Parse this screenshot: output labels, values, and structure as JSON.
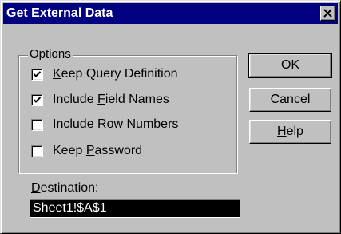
{
  "dialog": {
    "title": "Get External Data",
    "close_icon": "close-x-icon"
  },
  "options": {
    "group_label": "Options",
    "items": [
      {
        "pre": "",
        "key": "K",
        "post": "eep Query Definition",
        "checked": true
      },
      {
        "pre": "Include ",
        "key": "F",
        "post": "ield Names",
        "checked": true
      },
      {
        "pre": "",
        "key": "I",
        "post": "nclude Row Numbers",
        "checked": false
      },
      {
        "pre": "Keep ",
        "key": "P",
        "post": "assword",
        "checked": false
      }
    ]
  },
  "buttons": {
    "ok": "OK",
    "cancel": "Cancel",
    "help_key": "H",
    "help_rest": "elp"
  },
  "destination": {
    "label_key": "D",
    "label_rest": "estination:",
    "value": "Sheet1!$A$1"
  }
}
